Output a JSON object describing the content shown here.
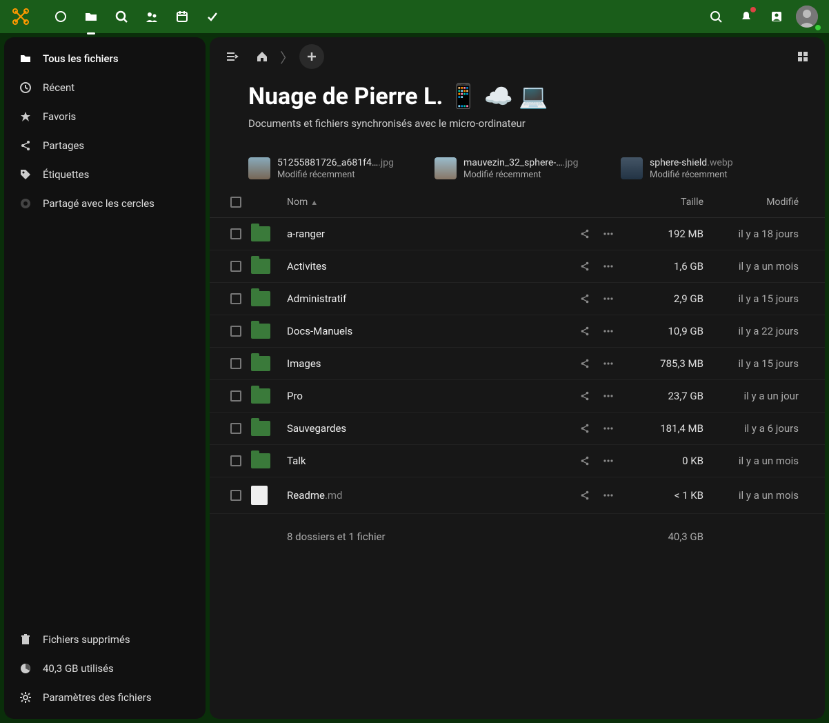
{
  "topbar": {
    "apps": [
      "dashboard",
      "files",
      "search-app",
      "social",
      "calendar",
      "tasks"
    ]
  },
  "sidebar": {
    "items": [
      {
        "label": "Tous les fichiers",
        "icon": "folder"
      },
      {
        "label": "Récent",
        "icon": "clock"
      },
      {
        "label": "Favoris",
        "icon": "star"
      },
      {
        "label": "Partages",
        "icon": "share"
      },
      {
        "label": "Étiquettes",
        "icon": "tag"
      },
      {
        "label": "Partagé avec les cercles",
        "icon": "circle"
      }
    ],
    "bottom": [
      {
        "label": "Fichiers supprimés",
        "icon": "trash"
      },
      {
        "label": "40,3 GB utilisés",
        "icon": "pie"
      },
      {
        "label": "Paramètres des fichiers",
        "icon": "gear"
      }
    ]
  },
  "page": {
    "title": "Nuage de Pierre L. 📱 ☁️ 💻",
    "subtitle": "Documents et fichiers synchronisés avec le micro-ordinateur"
  },
  "recent": [
    {
      "name": "51255881726_a681f4…",
      "ext": ".jpg",
      "sub": "Modifié récemment"
    },
    {
      "name": "mauvezin_32_sphere-…",
      "ext": ".jpg",
      "sub": "Modifié récemment"
    },
    {
      "name": "sphere-shield",
      "ext": ".webp",
      "sub": "Modifié récemment"
    }
  ],
  "columns": {
    "name": "Nom",
    "size": "Taille",
    "modified": "Modifié"
  },
  "rows": [
    {
      "type": "folder",
      "name": "a-ranger",
      "ext": "",
      "size": "192 MB",
      "modified": "il y a 18 jours"
    },
    {
      "type": "folder",
      "name": "Activites",
      "ext": "",
      "size": "1,6 GB",
      "modified": "il y a un mois"
    },
    {
      "type": "folder",
      "name": "Administratif",
      "ext": "",
      "size": "2,9 GB",
      "modified": "il y a 15 jours"
    },
    {
      "type": "folder",
      "name": "Docs-Manuels",
      "ext": "",
      "size": "10,9 GB",
      "modified": "il y a 22 jours"
    },
    {
      "type": "folder",
      "name": "Images",
      "ext": "",
      "size": "785,3 MB",
      "modified": "il y a 15 jours"
    },
    {
      "type": "folder",
      "name": "Pro",
      "ext": "",
      "size": "23,7 GB",
      "modified": "il y a un jour"
    },
    {
      "type": "folder",
      "name": "Sauvegardes",
      "ext": "",
      "size": "181,4 MB",
      "modified": "il y a 6 jours"
    },
    {
      "type": "folder",
      "name": "Talk",
      "ext": "",
      "size": "0 KB",
      "modified": "il y a un mois"
    },
    {
      "type": "file",
      "name": "Readme",
      "ext": ".md",
      "size": "< 1 KB",
      "modified": "il y a un mois"
    }
  ],
  "summary": {
    "text": "8 dossiers et 1 fichier",
    "total": "40,3 GB"
  }
}
